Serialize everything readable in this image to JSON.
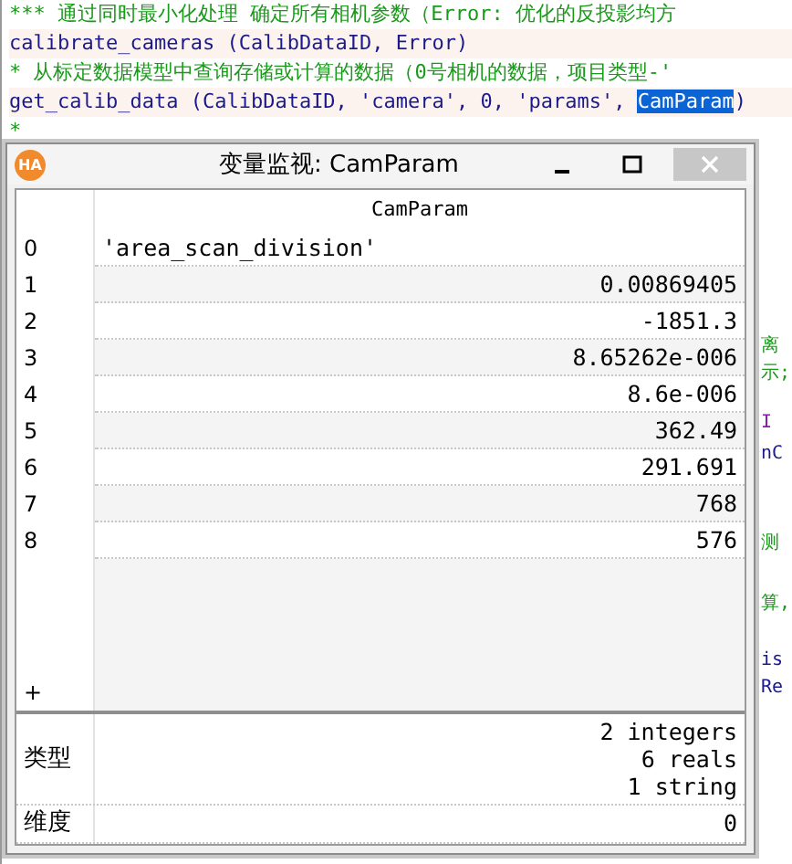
{
  "editor": {
    "lines": [
      {
        "current": false,
        "segments": [
          {
            "text": "*** 通过同时最小化处理 确定所有相机参数（Error: 优化的反投影均方",
            "kind": "comment"
          }
        ]
      },
      {
        "current": true,
        "segments": [
          {
            "text": "calibrate_cameras (CalibDataID, Error)",
            "kind": "code"
          }
        ]
      },
      {
        "current": false,
        "segments": [
          {
            "text": "* 从标定数据模型中查询存储或计算的数据（0号相机的数据，项目类型-'",
            "kind": "comment"
          }
        ]
      },
      {
        "current": true,
        "segments": [
          {
            "text": "get_calib_data (CalibDataID, 'camera', 0, 'params', ",
            "kind": "code"
          },
          {
            "text": "CamParam",
            "kind": "selected"
          },
          {
            "text": ")",
            "kind": "code"
          }
        ]
      },
      {
        "current": false,
        "segments": [
          {
            "text": "*",
            "kind": "comment"
          }
        ]
      }
    ],
    "side_fragments": [
      {
        "text": "离",
        "kind": "comment"
      },
      {
        "text": "示;",
        "kind": "comment"
      },
      {
        "text": "I",
        "kind": "keyword"
      },
      {
        "text": "nC",
        "kind": "code"
      },
      {
        "text": "测",
        "kind": "comment"
      },
      {
        "text": "算,",
        "kind": "comment"
      },
      {
        "text": "is",
        "kind": "code"
      },
      {
        "text": "Re",
        "kind": "code"
      }
    ]
  },
  "window": {
    "title": "变量监视: CamParam",
    "icon_text": "HA",
    "table": {
      "column": "CamParam",
      "rows": [
        {
          "index": "0",
          "value": "'area_scan_division'",
          "kind": "string"
        },
        {
          "index": "1",
          "value": "0.00869405",
          "kind": "number"
        },
        {
          "index": "2",
          "value": "-1851.3",
          "kind": "number"
        },
        {
          "index": "3",
          "value": "8.65262e-006",
          "kind": "number"
        },
        {
          "index": "4",
          "value": "8.6e-006",
          "kind": "number"
        },
        {
          "index": "5",
          "value": "362.49",
          "kind": "number"
        },
        {
          "index": "6",
          "value": "291.691",
          "kind": "number"
        },
        {
          "index": "7",
          "value": "768",
          "kind": "number"
        },
        {
          "index": "8",
          "value": "576",
          "kind": "number"
        }
      ],
      "add_marker": "+"
    },
    "info": [
      {
        "label": "类型",
        "values": [
          "2 integers",
          "6 reals",
          "1 string"
        ]
      },
      {
        "label": "维度",
        "values": [
          "0"
        ]
      }
    ]
  }
}
